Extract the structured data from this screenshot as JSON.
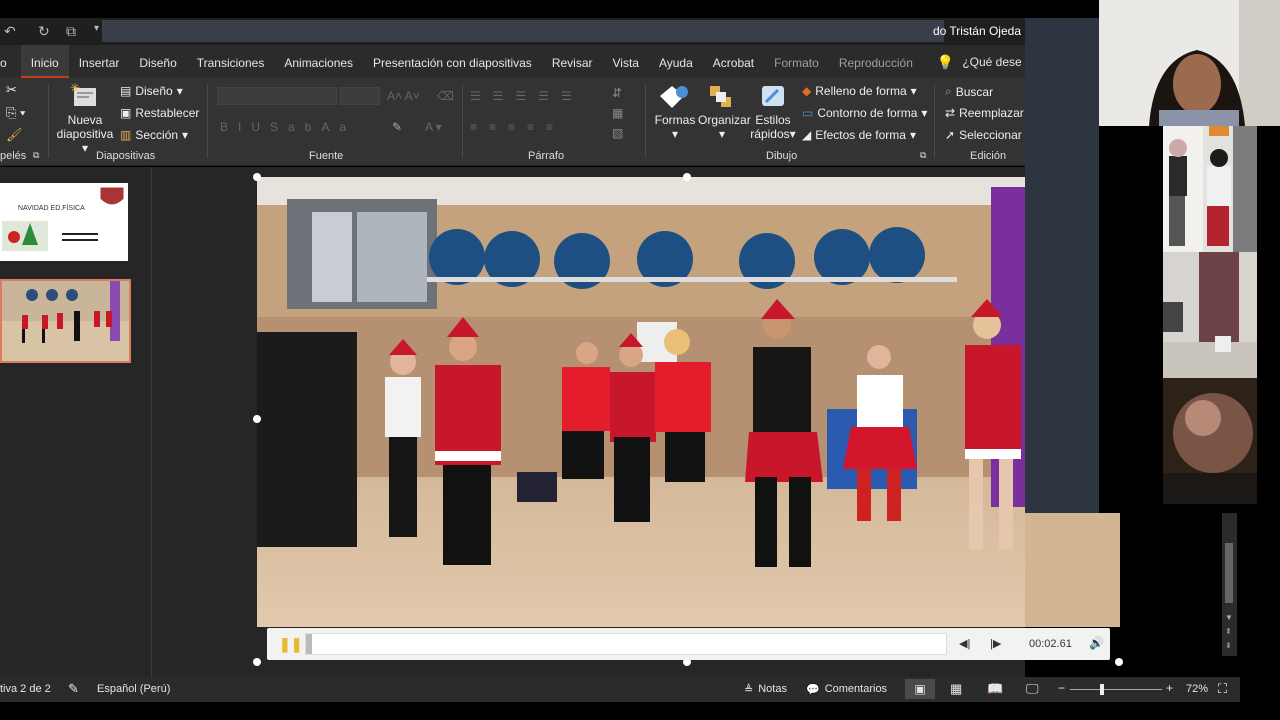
{
  "titlebar": {
    "user": "do Tristán Ojeda"
  },
  "tabs": [
    {
      "label": "o"
    },
    {
      "label": "Inicio"
    },
    {
      "label": "Insertar"
    },
    {
      "label": "Diseño"
    },
    {
      "label": "Transiciones"
    },
    {
      "label": "Animaciones"
    },
    {
      "label": "Presentación con diapositivas"
    },
    {
      "label": "Revisar"
    },
    {
      "label": "Vista"
    },
    {
      "label": "Ayuda"
    },
    {
      "label": "Acrobat"
    },
    {
      "label": "Formato"
    },
    {
      "label": "Reproducción"
    }
  ],
  "tell_me": "¿Qué dese",
  "ribbon": {
    "clipboard_label": "pelés",
    "slides": {
      "new_slide": "Nueva",
      "new_slide2": "diapositiva",
      "layout": "Diseño",
      "reset": "Restablecer",
      "section": "Sección",
      "label": "Diapositivas"
    },
    "font_label": "Fuente",
    "paragraph_label": "Párrafo",
    "drawing": {
      "shapes": "Formas",
      "arrange": "Organizar",
      "quick_styles": "Estilos",
      "quick_styles2": "rápidos",
      "fill": "Relleno de forma",
      "outline": "Contorno de forma",
      "effects": "Efectos de forma",
      "label": "Dibujo"
    },
    "editing": {
      "find": "Buscar",
      "replace": "Reemplazar",
      "select": "Seleccionar",
      "label": "Edición"
    }
  },
  "thumbnail1": {
    "title": "NAVIDAD ED.FÍSICA"
  },
  "player": {
    "time": "00:02.61"
  },
  "status": {
    "slide": "tiva 2 de 2",
    "language": "Español (Perú)",
    "notes": "Notas",
    "comments": "Comentarios",
    "zoom": "72%"
  },
  "colors": {
    "accent": "#c43e1c",
    "ribbon": "#333333",
    "status": "#2b2b2b"
  }
}
